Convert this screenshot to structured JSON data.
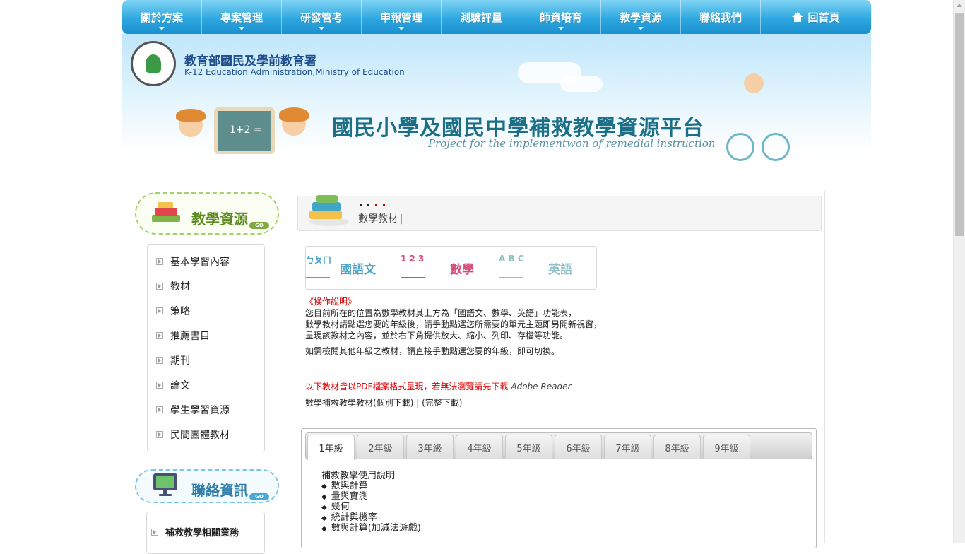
{
  "nav": {
    "items": [
      "關於方案",
      "專案管理",
      "研發管考",
      "申報管理",
      "測驗評量",
      "師資培育",
      "教學資源",
      "聯絡我們"
    ],
    "home_label": "回首頁"
  },
  "banner": {
    "org_cn": "教育部國民及學前教育署",
    "org_en": "K-12 Education Administration,Ministry of Education",
    "site_title": "國民小學及國民中學補救教學資源平台",
    "site_subtitle": "Project for the implementwon of remedial instruction",
    "board_text": "1+2 ="
  },
  "sidebar": {
    "title": "教學資源",
    "go_label": "GO",
    "items": [
      "基本學習內容",
      "教材",
      "策略",
      "推薦書目",
      "期刊",
      "論文",
      "學生學習資源",
      "民間團體教材"
    ],
    "contact_title": "聯絡資訊",
    "contact_items": [
      "補救教學相關業務"
    ]
  },
  "breadcrumb": {
    "label": "數學教材"
  },
  "subjects": [
    {
      "glyph": "ㄅㄆㄇ",
      "label": "國語文",
      "color": "#4aa3c9"
    },
    {
      "glyph": "1 2 3",
      "label": "數學",
      "color": "#d44d7a"
    },
    {
      "glyph": "A B C",
      "label": "英語",
      "color": "#8fc3c8"
    }
  ],
  "instructions": {
    "title": "《操作說明》",
    "line1": "您目前所在的位置為數學教材其上方為「國語文、數學、英語」功能表，",
    "line2": "數學教材請點選您要的年級後，請手動點選您所需要的單元主題即另開新視窗，",
    "line3": "呈現該教材之內容，並於右下角提供放大、縮小、列印、存檔等功能。",
    "line4": "如需檢閱其他年級之教材，請直接手動點選您要的年級，即可切換。"
  },
  "pdf_note": {
    "text": "以下教材皆以PDF檔案格式呈現，若無法瀏覽請先下載",
    "reader": "Adobe Reader"
  },
  "download": {
    "prefix": "數學補救教學教材",
    "individual": "(個別下載)",
    "separator": " | ",
    "complete": "(完整下載)"
  },
  "grades": {
    "tabs": [
      "1年級",
      "2年級",
      "3年級",
      "4年級",
      "5年級",
      "6年級",
      "7年級",
      "8年級",
      "9年級"
    ],
    "active": "1年級",
    "content_title": "補救教學使用說明",
    "content_items": [
      "數與計算",
      "量與實測",
      "幾何",
      "統計與機率",
      "數與計算(加減法遊戲)"
    ]
  }
}
